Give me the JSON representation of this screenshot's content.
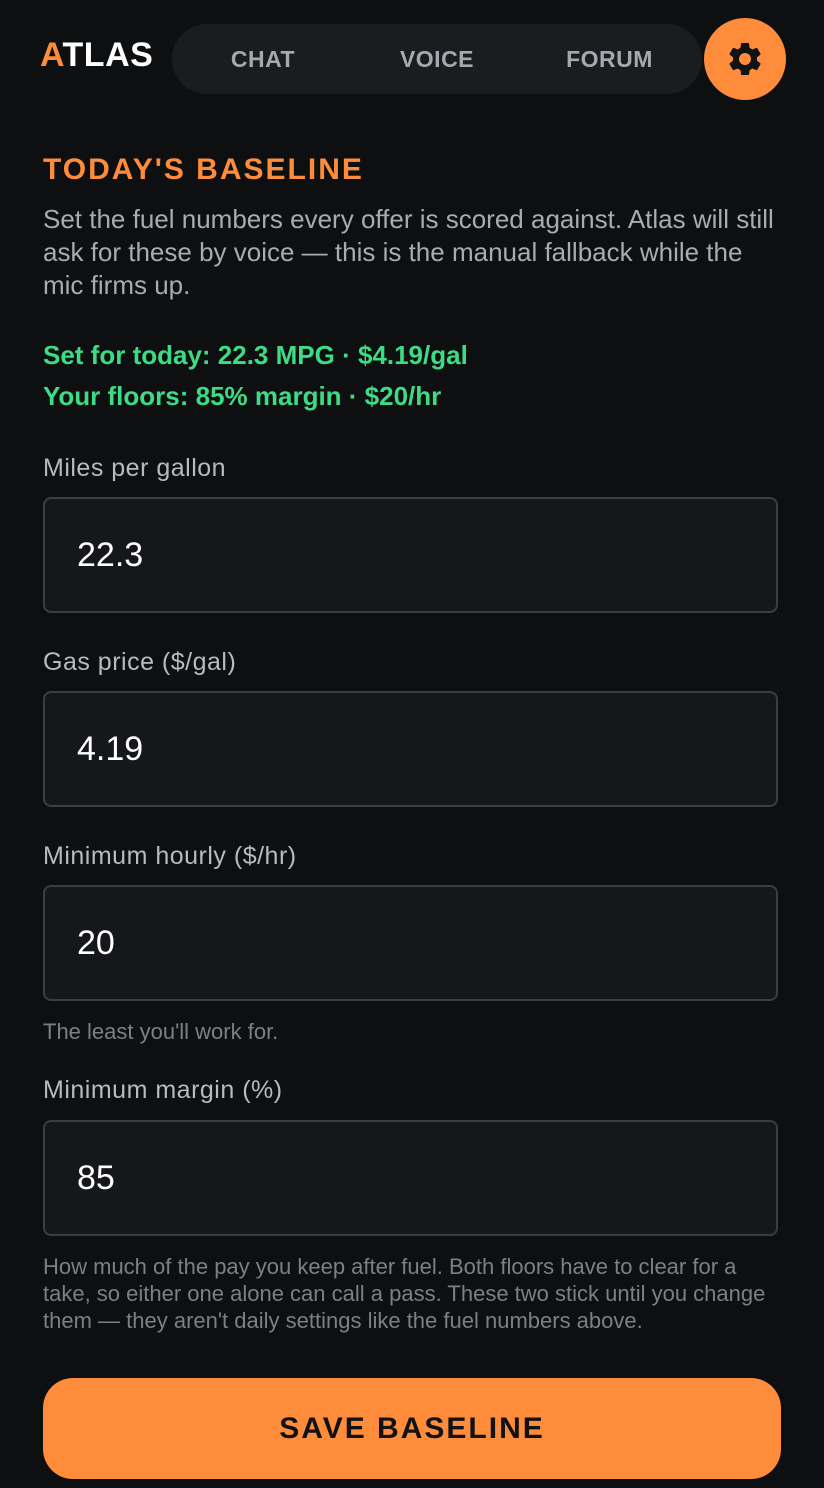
{
  "header": {
    "logo_accent": "A",
    "logo_rest": "TLAS",
    "tabs": [
      {
        "label": "CHAT"
      },
      {
        "label": "VOICE"
      },
      {
        "label": "FORUM"
      }
    ],
    "settings_icon": "gear-icon"
  },
  "baseline": {
    "title": "TODAY'S BASELINE",
    "intro": "Set the fuel numbers every offer is scored against. Atlas will still ask for these by voice — this is the manual fallback while the mic firms up.",
    "status_today": "Set for today: 22.3 MPG · $4.19/gal",
    "status_floors": "Your floors: 85% margin · $20/hr"
  },
  "fields": {
    "mpg": {
      "label": "Miles per gallon",
      "value": "22.3"
    },
    "gas_price": {
      "label": "Gas price ($/gal)",
      "value": "4.19"
    },
    "min_hourly": {
      "label": "Minimum hourly ($/hr)",
      "value": "20",
      "hint": "The least you'll work for."
    },
    "min_margin": {
      "label": "Minimum margin (%)",
      "value": "85",
      "hint": "How much of the pay you keep after fuel. Both floors have to clear for a take, so either one alone can call a pass. These two stick until you change them — they aren't daily settings like the fuel numbers above."
    }
  },
  "actions": {
    "save_label": "SAVE BASELINE"
  },
  "colors": {
    "accent": "#ff8c3a",
    "success": "#3ddc84",
    "background": "#0e0f11"
  }
}
